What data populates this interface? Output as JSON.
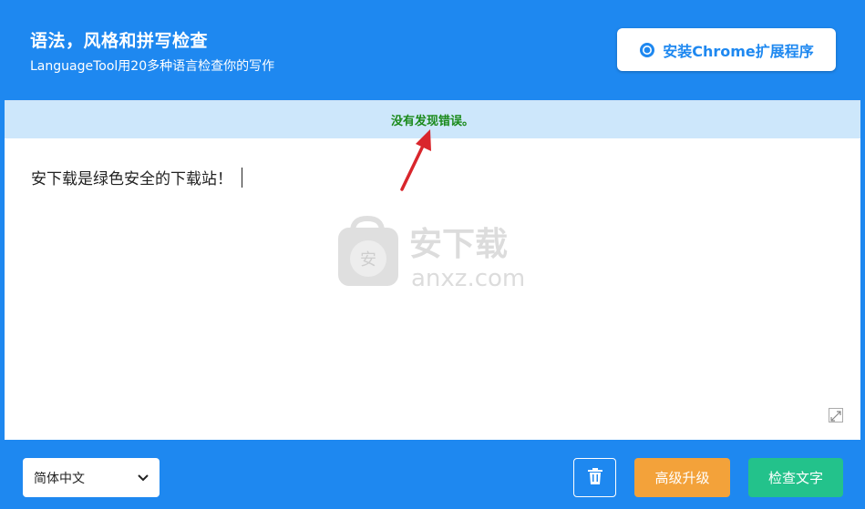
{
  "header": {
    "title": "语法，风格和拼写检查",
    "subtitle": "LanguageTool用20多种语言检查你的写作",
    "chrome_button_label": "安装Chrome扩展程序",
    "chrome_icon": "chrome-icon"
  },
  "status": {
    "message": "没有发现错误。"
  },
  "editor": {
    "text": "安下载是绿色安全的下载站！",
    "watermark": {
      "brand": "安下载",
      "domain": "anxz.com",
      "badge": "安"
    }
  },
  "footer": {
    "language": {
      "selected": "简体中文"
    },
    "upgrade_label": "高级升级",
    "check_label": "检查文字"
  },
  "colors": {
    "primary": "#1e88f0",
    "status_bg": "#cde7fb",
    "status_text": "#1a8a1a",
    "upgrade": "#f3a23a",
    "check": "#23c28b",
    "annotation_arrow": "#d9262c"
  }
}
